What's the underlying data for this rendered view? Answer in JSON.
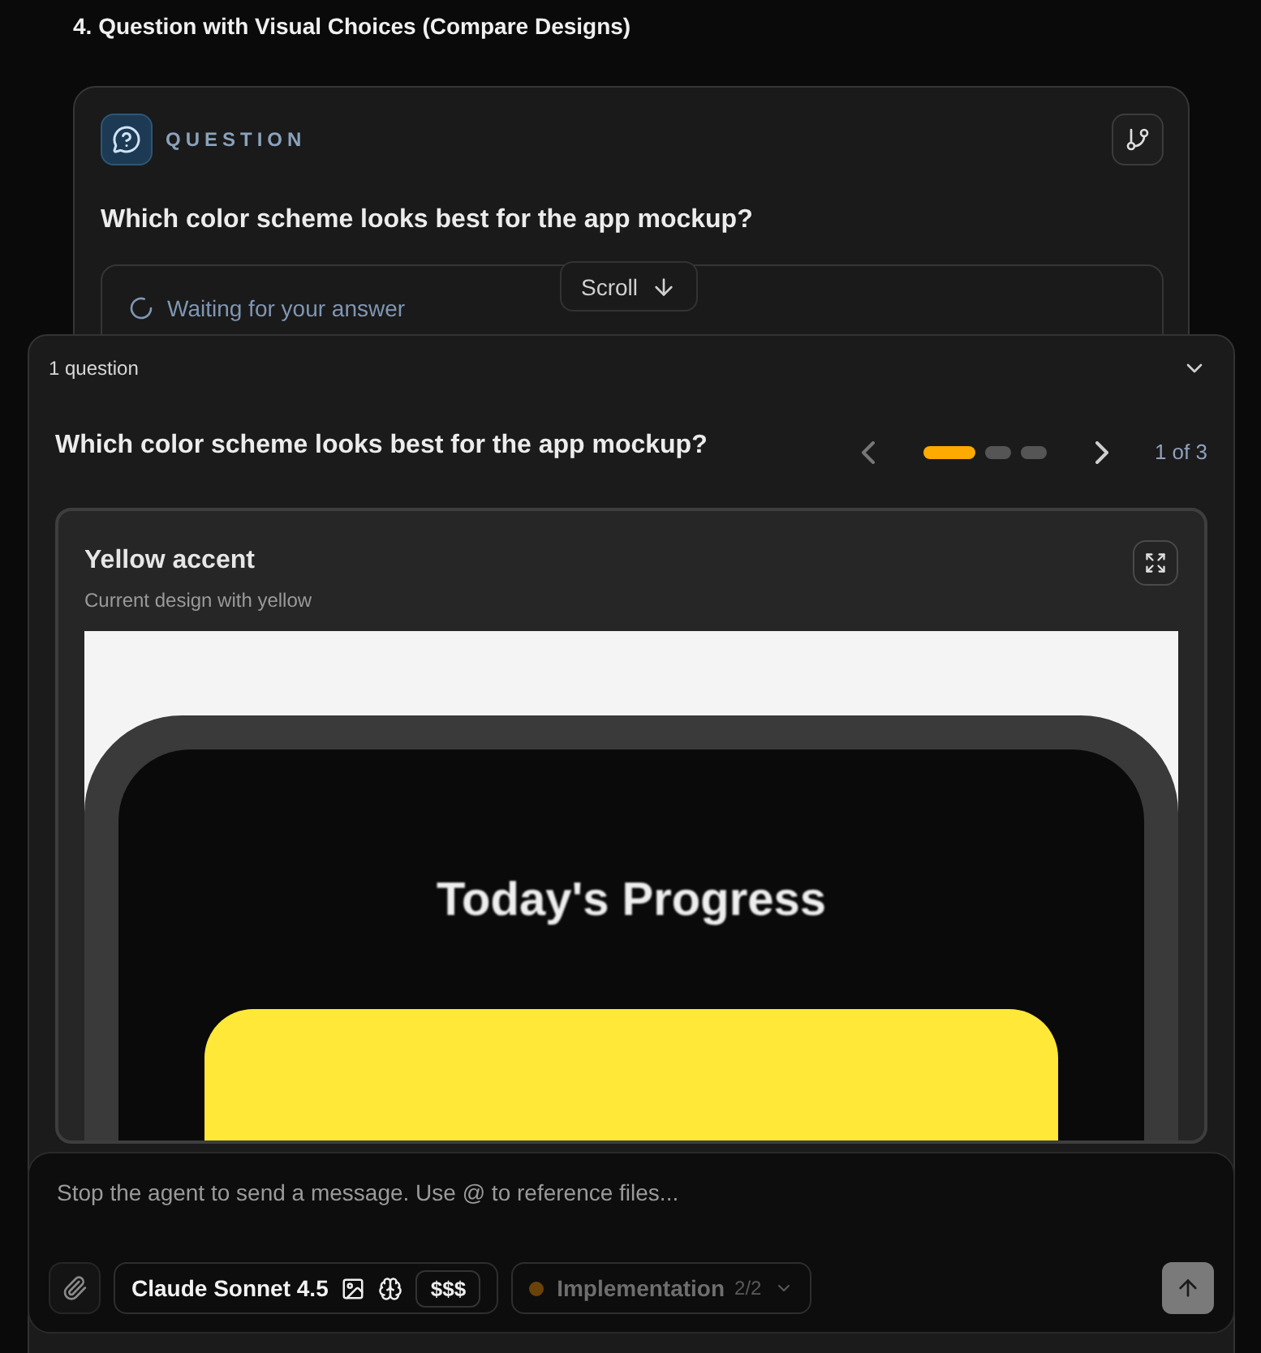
{
  "section_heading": "4. Question with Visual Choices (Compare Designs)",
  "question_card": {
    "badge": "QUESTION",
    "question": "Which color scheme looks best for the app mockup?",
    "status": "Waiting for your answer"
  },
  "scroll_button": {
    "label": "Scroll"
  },
  "panel": {
    "count_label": "1 question",
    "expanded": true,
    "question": "Which color scheme looks best for the app mockup?",
    "pager": {
      "dots": [
        {
          "selected": true
        },
        {
          "selected": false
        },
        {
          "selected": false
        }
      ],
      "label": "1 of 3"
    },
    "option": {
      "title": "Yellow accent",
      "subtitle": "Current design with yellow",
      "mockup": {
        "title": "Today's Progress"
      }
    }
  },
  "composer": {
    "placeholder": "Stop the agent to send a message. Use @ to reference files...",
    "model": "Claude Sonnet 4.5",
    "price": "$$$",
    "mode": {
      "label": "Implementation",
      "count": "2/2",
      "color": "#6b4208"
    },
    "send_disabled": true
  }
}
